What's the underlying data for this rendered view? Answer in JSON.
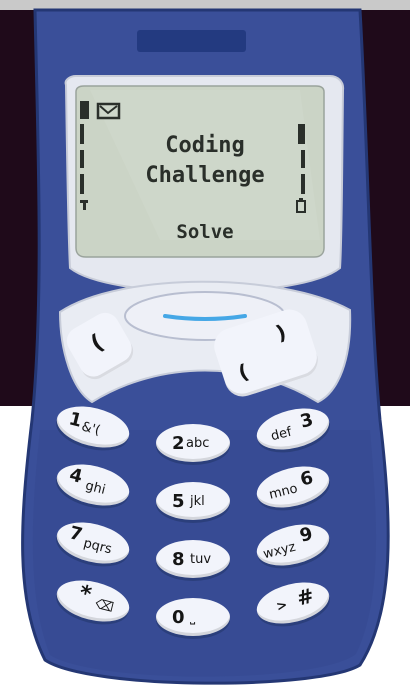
{
  "screen": {
    "title_line1": "Coding",
    "title_line2": "Challenge",
    "softkey_label": "Solve"
  },
  "icons": {
    "message": "message-envelope-icon",
    "antenna": "antenna-icon",
    "battery": "battery-icon",
    "signal": "signal-bars",
    "battery_bars": "battery-bars"
  },
  "softkeys": {
    "left_glyph": "(",
    "right_glyph": ")",
    "lower_left_glyph": "("
  },
  "keypad": {
    "k1": {
      "num": "1",
      "sub": "&'("
    },
    "k2": {
      "num": "2",
      "sub": "abc"
    },
    "k3": {
      "num": "3",
      "sub": "def"
    },
    "k4": {
      "num": "4",
      "sub": "ghi"
    },
    "k5": {
      "num": "5",
      "sub": "jkl"
    },
    "k6": {
      "num": "6",
      "sub": "mno"
    },
    "k7": {
      "num": "7",
      "sub": "pqrs"
    },
    "k8": {
      "num": "8",
      "sub": "tuv"
    },
    "k9": {
      "num": "9",
      "sub": "wxyz"
    },
    "kstar": {
      "num": "*",
      "sub": "⌫"
    },
    "k0": {
      "num": "0",
      "sub": "⎵"
    },
    "khash": {
      "num": "#",
      "sub": ">"
    }
  },
  "colors": {
    "phone_blue": "#3b4f98",
    "phone_dark_blue": "#2b3f7c",
    "screen_bezel": "#d9dde8",
    "lcd": "#c9d3c4",
    "nav_blue": "#45a7e6",
    "background_dark": "#1f0a1a"
  }
}
